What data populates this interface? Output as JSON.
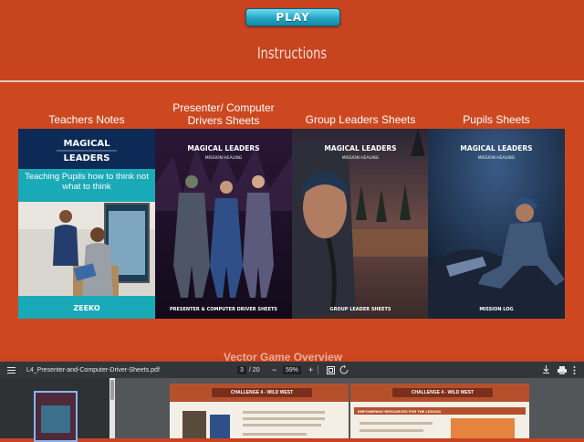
{
  "header": {
    "play_label": "PLAY",
    "instructions": "Instructions"
  },
  "columns": [
    {
      "title": "Teachers Notes"
    },
    {
      "title": "Presenter/ Computer Drivers Sheets"
    },
    {
      "title": "Group Leaders Sheets"
    },
    {
      "title": "Pupils Sheets"
    }
  ],
  "covers": {
    "teachers": {
      "brand": "MAGICAL LEADERS",
      "tagline": "Teaching Pupils how to think not what to think",
      "publisher": "ZEEKO"
    },
    "presenter": {
      "brand": "MAGICAL LEADERS",
      "subtitle": "MISSION HEALING",
      "footer": "PRESENTER & COMPUTER DRIVER SHEETS"
    },
    "group": {
      "brand": "MAGICAL LEADERS",
      "subtitle": "MISSION HEALING",
      "footer": "GROUP LEADER SHEETS"
    },
    "pupils": {
      "brand": "MAGICAL LEADERS",
      "subtitle": "MISSION HEALING",
      "footer": "MISSION LOG"
    }
  },
  "partial_heading": "Vector Game Overview",
  "pdf_toolbar": {
    "filename": "L4_Presenter-and-Computer-Driver-Sheets.pdf",
    "page_current": "3",
    "page_total": "/ 20",
    "zoom": "59%"
  },
  "pdf_pages": [
    {
      "banner": "CHALLENGE 4 - WILD WEST"
    },
    {
      "banner": "CHALLENGE 4 - WILD WEST",
      "heading": "EMPOWERING RESOURCES FOR THE LESSON"
    }
  ],
  "colors": {
    "background": "#c8431f",
    "play_button": "#25a3c4",
    "pdf_toolbar": "#323639"
  }
}
